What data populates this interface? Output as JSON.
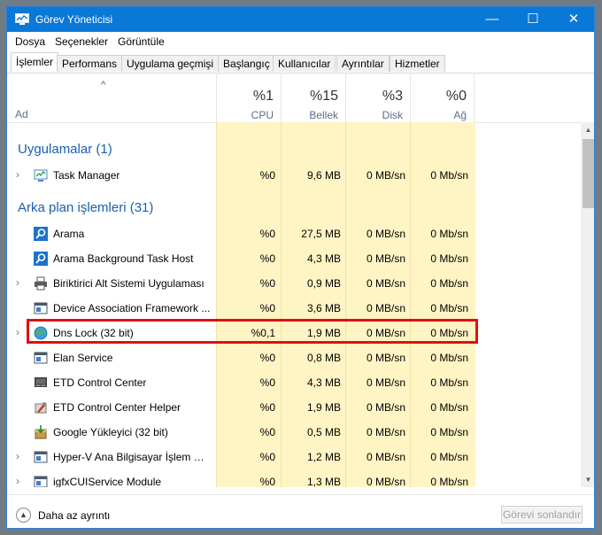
{
  "window": {
    "title": "Görev Yöneticisi"
  },
  "menu": [
    "Dosya",
    "Seçenekler",
    "Görüntüle"
  ],
  "tabs": [
    "İşlemler",
    "Performans",
    "Uygulama geçmişi",
    "Başlangıç",
    "Kullanıcılar",
    "Ayrıntılar",
    "Hizmetler"
  ],
  "columns": {
    "name": "Ad",
    "cpu": {
      "pct": "%1",
      "label": "CPU"
    },
    "mem": {
      "pct": "%15",
      "label": "Bellek"
    },
    "disk": {
      "pct": "%3",
      "label": "Disk"
    },
    "net": {
      "pct": "%0",
      "label": "Ağ"
    }
  },
  "groups": {
    "apps": "Uygulamalar (1)",
    "background": "Arka plan işlemleri (31)"
  },
  "rows": [
    {
      "name": "Task Manager",
      "cpu": "%0",
      "mem": "9,6 MB",
      "disk": "0 MB/sn",
      "net": "0 Mb/sn",
      "icon": "task-manager-icon"
    },
    {
      "name": "Arama",
      "cpu": "%0",
      "mem": "27,5 MB",
      "disk": "0 MB/sn",
      "net": "0 Mb/sn",
      "icon": "search-icon"
    },
    {
      "name": "Arama Background Task Host",
      "cpu": "%0",
      "mem": "4,3 MB",
      "disk": "0 MB/sn",
      "net": "0 Mb/sn",
      "icon": "search-icon"
    },
    {
      "name": "Biriktirici Alt Sistemi Uygulaması",
      "cpu": "%0",
      "mem": "0,9 MB",
      "disk": "0 MB/sn",
      "net": "0 Mb/sn",
      "icon": "printer-icon"
    },
    {
      "name": "Device Association Framework ...",
      "cpu": "%0",
      "mem": "3,6 MB",
      "disk": "0 MB/sn",
      "net": "0 Mb/sn",
      "icon": "service-window-icon"
    },
    {
      "name": "Dns Lock (32 bit)",
      "cpu": "%0,1",
      "mem": "1,9 MB",
      "disk": "0 MB/sn",
      "net": "0 Mb/sn",
      "icon": "globe-icon"
    },
    {
      "name": "Elan Service",
      "cpu": "%0",
      "mem": "0,8 MB",
      "disk": "0 MB/sn",
      "net": "0 Mb/sn",
      "icon": "service-window-icon"
    },
    {
      "name": "ETD Control Center",
      "cpu": "%0",
      "mem": "4,3 MB",
      "disk": "0 MB/sn",
      "net": "0 Mb/sn",
      "icon": "touchpad-icon"
    },
    {
      "name": "ETD Control Center Helper",
      "cpu": "%0",
      "mem": "1,9 MB",
      "disk": "0 MB/sn",
      "net": "0 Mb/sn",
      "icon": "wrench-icon"
    },
    {
      "name": "Google Yükleyici (32 bit)",
      "cpu": "%0",
      "mem": "0,5 MB",
      "disk": "0 MB/sn",
      "net": "0 Mb/sn",
      "icon": "installer-icon"
    },
    {
      "name": "Hyper-V Ana Bilgisayar İşlem Hi...",
      "cpu": "%0",
      "mem": "1,2 MB",
      "disk": "0 MB/sn",
      "net": "0 Mb/sn",
      "icon": "service-window-icon"
    },
    {
      "name": "igfxCUIService Module",
      "cpu": "%0",
      "mem": "1,3 MB",
      "disk": "0 MB/sn",
      "net": "0 Mb/sn",
      "icon": "service-window-icon"
    }
  ],
  "footer": {
    "fewer_details": "Daha az ayrıntı",
    "end_task": "Görevi sonlandır"
  },
  "colors": {
    "titlebar": "#0a78d7",
    "column_highlight": "#fff4c4",
    "group_text": "#1a5fb4",
    "selection_box": "#e01010"
  }
}
